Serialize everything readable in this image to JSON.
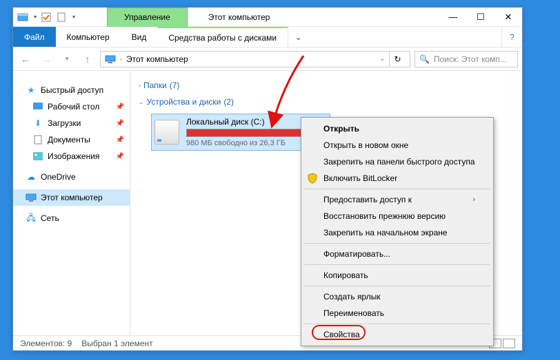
{
  "titlebar": {
    "manage": "Управление",
    "title": "Этот компьютер"
  },
  "ribbon": {
    "file": "Файл",
    "computer": "Компьютер",
    "view": "Вид",
    "disk_tools": "Средства работы с дисками"
  },
  "breadcrumb": {
    "label": "Этот компьютер"
  },
  "search": {
    "placeholder": "Поиск: Этот комп..."
  },
  "sidebar": {
    "quick": "Быстрый доступ",
    "desktop": "Рабочий стол",
    "downloads": "Загрузки",
    "documents": "Документы",
    "pictures": "Изображения",
    "onedrive": "OneDrive",
    "thispc": "Этот компьютер",
    "network": "Сеть"
  },
  "main": {
    "folders": {
      "label": "Папки",
      "count": "(7)"
    },
    "devices": {
      "label": "Устройства и диски",
      "count": "(2)"
    },
    "drive": {
      "name": "Локальный диск (C:)",
      "free": "980 МБ свободно из 26,3 ГБ"
    }
  },
  "context": {
    "open": "Открыть",
    "open_new": "Открыть в новом окне",
    "pin_quick": "Закрепить на панели быстрого доступа",
    "bitlocker": "Включить BitLocker",
    "give_access": "Предоставить доступ к",
    "restore": "Восстановить прежнюю версию",
    "pin_start": "Закрепить на начальном экране",
    "format": "Форматировать...",
    "copy": "Копировать",
    "shortcut": "Создать ярлык",
    "rename": "Переименовать",
    "properties": "Свойства"
  },
  "status": {
    "items": "Элементов: 9",
    "selected": "Выбран 1 элемент"
  }
}
